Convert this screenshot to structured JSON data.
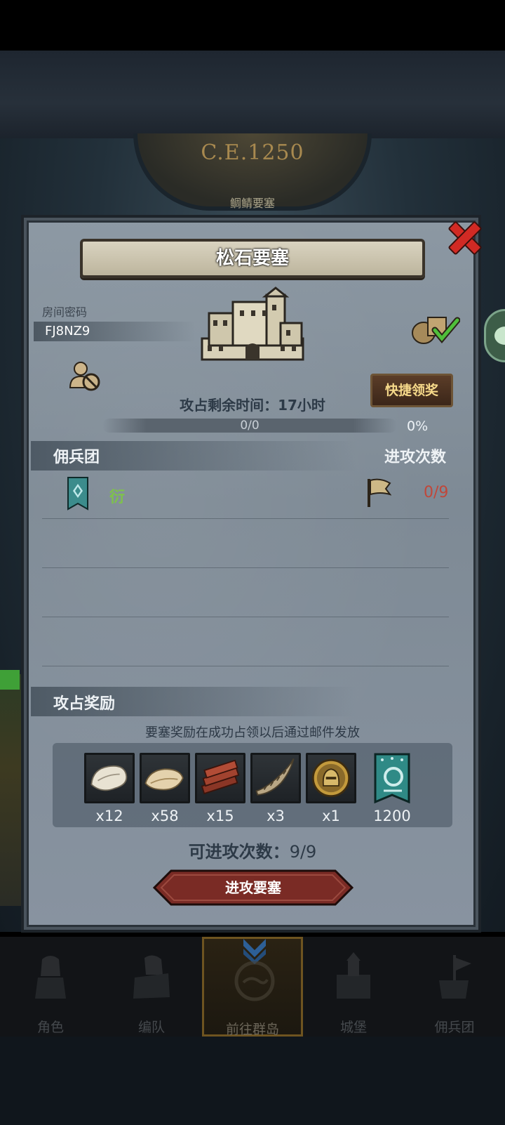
{
  "background": {
    "era": "C.E.1250",
    "era_subtitle": "鲷鲭要塞"
  },
  "dialog": {
    "title": "松石要塞",
    "room_password_label": "房间密码",
    "room_password": "FJ8NZ9",
    "quick_claim_label": "快捷领奖",
    "remaining_time": "攻占剩余时间：17小时",
    "progress": {
      "count": "0/0",
      "percent_label": "0%",
      "fraction": 0
    },
    "mercenary_header": "佣兵团",
    "attack_count_header": "进攻次数",
    "mercenary_row": {
      "guild_name": "衍",
      "attacks": "0/9"
    },
    "rewards_header": "攻占奖励",
    "rewards_hint": "要塞奖励在成功占领以后通过邮件发放",
    "rewards": [
      {
        "icon": "fur-pelt-icon",
        "qty": "x12"
      },
      {
        "icon": "hide-icon",
        "qty": "x58"
      },
      {
        "icon": "wood-planks-icon",
        "qty": "x15"
      },
      {
        "icon": "horn-icon",
        "qty": "x3"
      },
      {
        "icon": "knight-helmet-coin-icon",
        "qty": "x1"
      },
      {
        "icon": "guild-banner-icon",
        "qty": "1200"
      }
    ],
    "available_attacks_label": "可进攻次数：",
    "available_attacks": "9/9",
    "attack_button": "进攻要塞"
  },
  "nav": {
    "items": [
      {
        "label": "角色",
        "icon": "knight-icon"
      },
      {
        "label": "编队",
        "icon": "team-icon"
      },
      {
        "label": "前往群岛",
        "icon": "compass-icon",
        "active": true
      },
      {
        "label": "城堡",
        "icon": "castle-icon"
      },
      {
        "label": "佣兵团",
        "icon": "mercenary-icon"
      }
    ]
  },
  "colors": {
    "accent_red": "#d12a24",
    "guild_green": "#7ec24b",
    "attack_count_red": "#c0473a",
    "button_gold": "#f6d98a"
  }
}
